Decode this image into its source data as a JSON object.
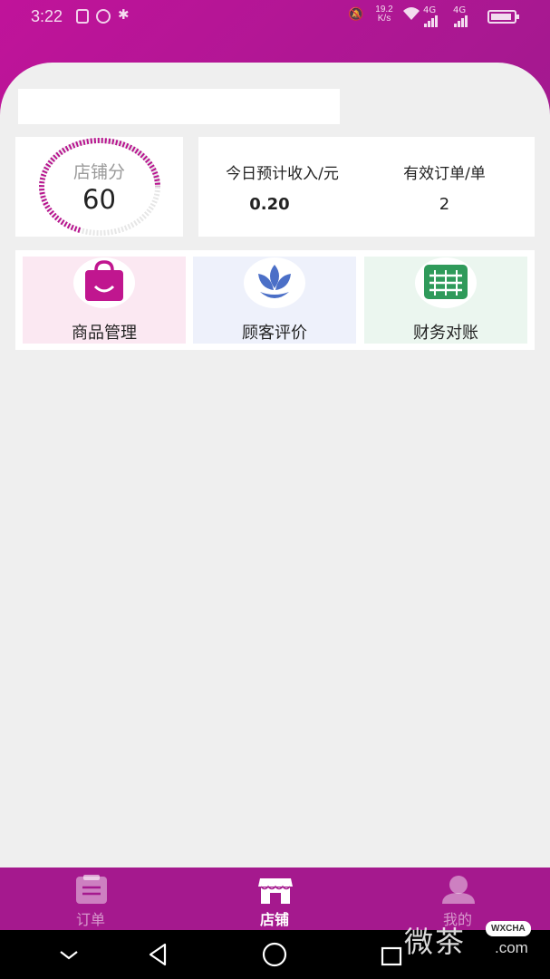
{
  "status_bar": {
    "time": "3:22",
    "net_speed_value": "19.2",
    "net_speed_unit": "K/s",
    "signal1_label": "4G",
    "signal2_label": "4G",
    "icons": [
      "nfc-icon",
      "alarm-icon",
      "bluetooth-icon",
      "mute-icon",
      "wifi-icon",
      "signal-icon",
      "battery-icon"
    ]
  },
  "store": {
    "name": ""
  },
  "score": {
    "label": "店铺分",
    "value": "60"
  },
  "stats": {
    "income_label": "今日预计收入/元",
    "income_value": "0.20",
    "orders_label": "有效订单/单",
    "orders_value": "2"
  },
  "features": [
    {
      "label": "商品管理",
      "icon": "shopping-bag-icon",
      "color": "#c0168f"
    },
    {
      "label": "顾客评价",
      "icon": "lotus-flower-icon",
      "color": "#4b6fc7"
    },
    {
      "label": "财务对账",
      "icon": "ledger-icon",
      "color": "#2f9a5a"
    }
  ],
  "tabs": [
    {
      "label": "订单",
      "icon": "clipboard-icon",
      "active": false
    },
    {
      "label": "店铺",
      "icon": "storefront-icon",
      "active": true
    },
    {
      "label": "我的",
      "icon": "user-icon",
      "active": false
    }
  ],
  "watermark": {
    "chinese": "微茶",
    "tag": "WXCHA",
    "domain": ".com"
  },
  "colors": {
    "brand": "#a5198e",
    "brand_light": "#c0139a",
    "sheet_bg": "#efefef"
  }
}
